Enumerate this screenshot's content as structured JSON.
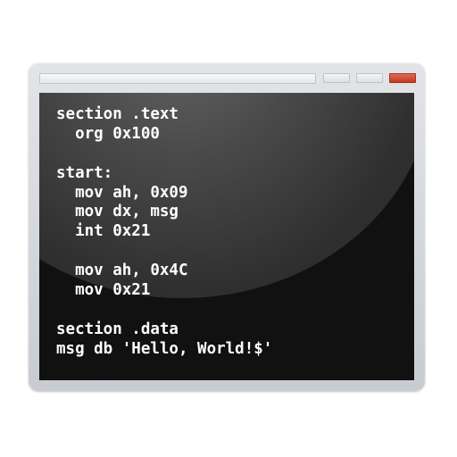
{
  "code": {
    "lines": [
      "section .text",
      "  org 0x100",
      "",
      "start:",
      "  mov ah, 0x09",
      "  mov dx, msg",
      "  int 0x21",
      "",
      "  mov ah, 0x4C",
      "  mov 0x21",
      "",
      "section .data",
      "msg db 'Hello, World!$'"
    ]
  }
}
